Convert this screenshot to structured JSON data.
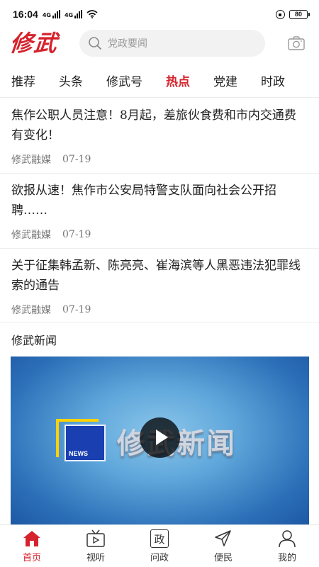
{
  "status_bar": {
    "time": "16:04",
    "signal_1_label": "4G",
    "signal_2_label": "4G",
    "battery": "80"
  },
  "header": {
    "logo": "修武",
    "search_placeholder": "党政要闻"
  },
  "tabs": [
    {
      "label": "推荐",
      "active": false
    },
    {
      "label": "头条",
      "active": false
    },
    {
      "label": "修武号",
      "active": false
    },
    {
      "label": "热点",
      "active": true
    },
    {
      "label": "党建",
      "active": false
    },
    {
      "label": "时政",
      "active": false
    }
  ],
  "articles": [
    {
      "title": "焦作公职人员注意！8月起，差旅伙食费和市内交通费有变化！",
      "source": "修武融媒",
      "date": "07-19"
    },
    {
      "title": "欲报从速！焦作市公安局特警支队面向社会公开招聘……",
      "source": "修武融媒",
      "date": "07-19"
    },
    {
      "title": "关于征集韩孟新、陈亮亮、崔海滨等人黑恶违法犯罪线索的通告",
      "source": "修武融媒",
      "date": "07-19"
    }
  ],
  "section": {
    "title": "修武新闻",
    "video_banner_text": "修武新闻",
    "video_logo_text": "NEWS"
  },
  "bottom_nav": [
    {
      "label": "首页",
      "icon": "home-icon",
      "active": true
    },
    {
      "label": "视听",
      "icon": "tv-icon",
      "active": false
    },
    {
      "label": "问政",
      "icon": "zheng-icon",
      "glyph": "政",
      "active": false
    },
    {
      "label": "便民",
      "icon": "send-icon",
      "active": false
    },
    {
      "label": "我的",
      "icon": "user-icon",
      "active": false
    }
  ],
  "colors": {
    "accent": "#d5232d",
    "search_bg": "#f2f2f2",
    "video_bg": "#2c70b8"
  }
}
